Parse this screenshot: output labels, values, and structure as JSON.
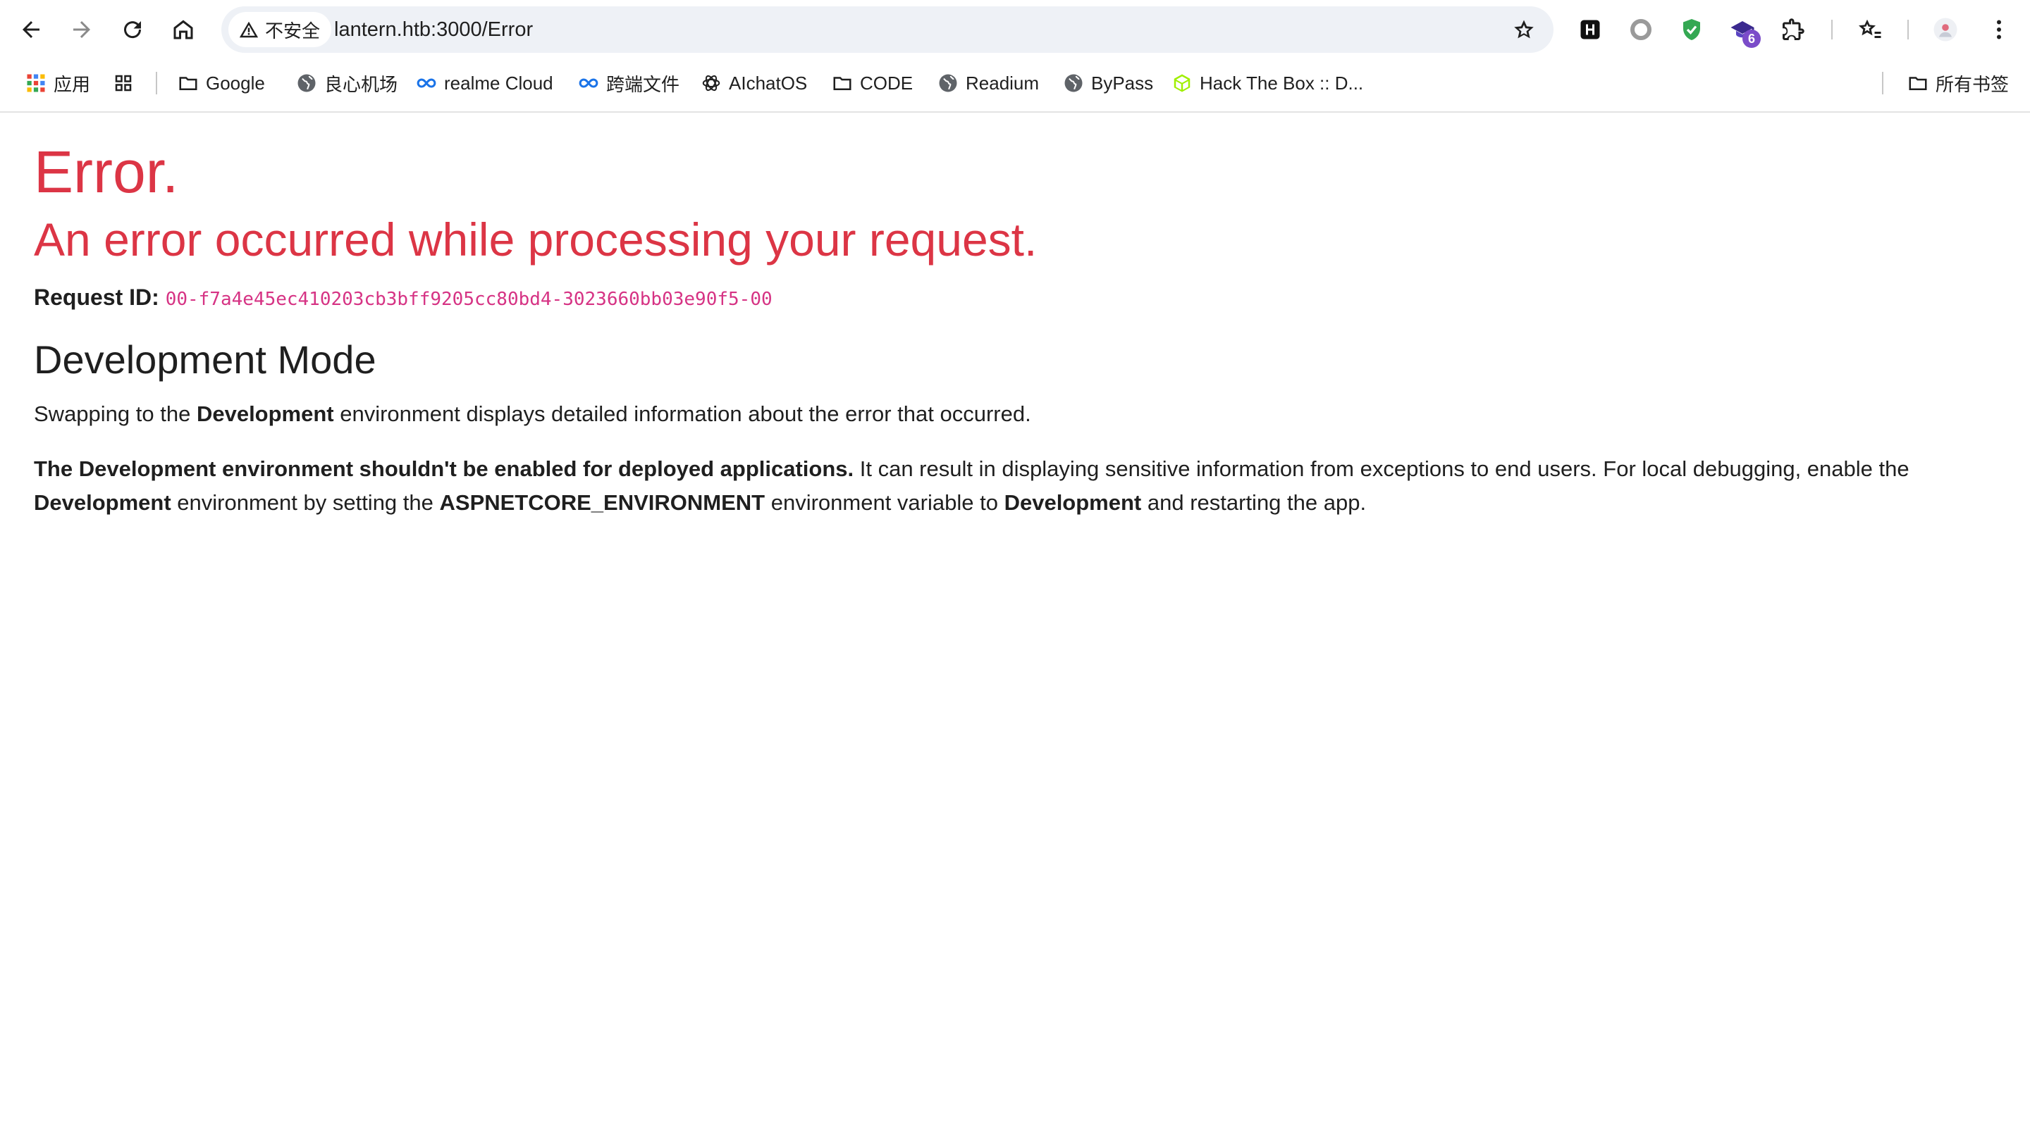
{
  "browser": {
    "security_label": "不安全",
    "url": "lantern.htb:3000/Error",
    "extension_badge": "6"
  },
  "bookmarks": [
    {
      "label": "应用",
      "icon": "apps-grid-icon"
    },
    {
      "label": "",
      "icon": "tab-groups-icon"
    },
    {
      "label": "Google",
      "icon": "folder-icon"
    },
    {
      "label": "良心机场",
      "icon": "globe-icon"
    },
    {
      "label": "realme Cloud",
      "icon": "infinity-icon"
    },
    {
      "label": "跨端文件",
      "icon": "infinity-icon"
    },
    {
      "label": "AIchatOS",
      "icon": "openai-icon"
    },
    {
      "label": "CODE",
      "icon": "folder-icon"
    },
    {
      "label": "Readium",
      "icon": "globe-icon"
    },
    {
      "label": "ByPass",
      "icon": "globe-icon"
    },
    {
      "label": "Hack The Box :: D...",
      "icon": "htb-cube-icon"
    }
  ],
  "all_bookmarks_label": "所有书签",
  "page": {
    "title": "Error.",
    "subtitle": "An error occurred while processing your request.",
    "request_label": "Request ID:",
    "request_id": "00-f7a4e45ec410203cb3bff9205cc80bd4-3023660bb03e90f5-00",
    "dev_heading": "Development Mode",
    "para1": {
      "pre": "Swapping to the ",
      "bold": "Development",
      "post": " environment displays detailed information about the error that occurred."
    },
    "para2": {
      "bold1": "The Development environment shouldn't be enabled for deployed applications.",
      "text1": " It can result in displaying sensitive information from exceptions to end users. For local debugging, enable the ",
      "bold2": "Development",
      "text2": " environment by setting the ",
      "bold3": "ASPNETCORE_ENVIRONMENT",
      "text3": " environment variable to ",
      "bold4": "Development",
      "text4": " and restarting the app."
    }
  },
  "colors": {
    "error_red": "#dc3545",
    "request_id_pink": "#d63384",
    "omnibox_bg": "#eef1f6"
  }
}
